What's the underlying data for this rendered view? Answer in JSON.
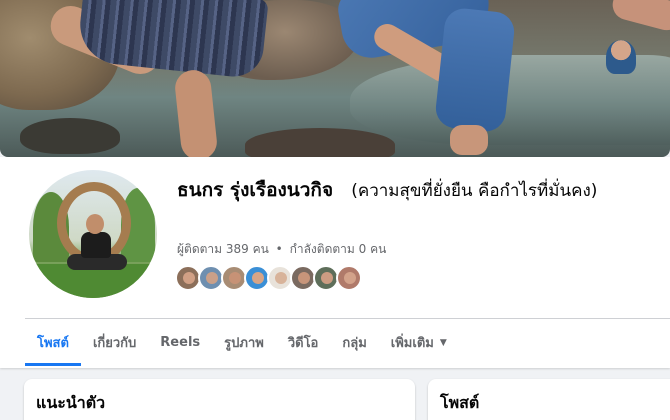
{
  "profile": {
    "name": "ธนกร รุ่งเรืองนวกิจ",
    "alternate_name": "(ความสุขที่ยั่งยืน คือกำไรที่มั่นคง)",
    "followers_text": "ผู้ติดตาม 389 คน",
    "following_text": "กำลังติดตาม 0 คน",
    "separator": "•"
  },
  "friend_avatars": [
    {
      "bg": "#8c6f5a",
      "skin": "#d1a085"
    },
    {
      "bg": "#6e8fb0",
      "skin": "#caa089"
    },
    {
      "bg": "#a88c74",
      "skin": "#c79276"
    },
    {
      "bg": "#3a8fd6",
      "skin": "#d7a587"
    },
    {
      "bg": "#e8e2da",
      "skin": "#d8b39a"
    },
    {
      "bg": "#7a6a60",
      "skin": "#c8957a"
    },
    {
      "bg": "#5e6e5a",
      "skin": "#cc9c82"
    },
    {
      "bg": "#b07a6a",
      "skin": "#d3a28a"
    }
  ],
  "tabs": [
    {
      "label": "โพสต์",
      "active": true
    },
    {
      "label": "เกี่ยวกับ",
      "active": false
    },
    {
      "label": "Reels",
      "active": false
    },
    {
      "label": "รูปภาพ",
      "active": false
    },
    {
      "label": "วิดีโอ",
      "active": false
    },
    {
      "label": "กลุ่ม",
      "active": false
    },
    {
      "label": "เพิ่มเติม",
      "active": false,
      "dropdown": true
    }
  ],
  "cards": {
    "intro_title": "แนะนำตัว",
    "posts_title": "โพสต์"
  },
  "colors": {
    "accent": "#1877f2",
    "secondary_text": "#65676b",
    "page_bg": "#f0f2f5"
  },
  "icons": {
    "more_caret": "caret-down-icon"
  }
}
